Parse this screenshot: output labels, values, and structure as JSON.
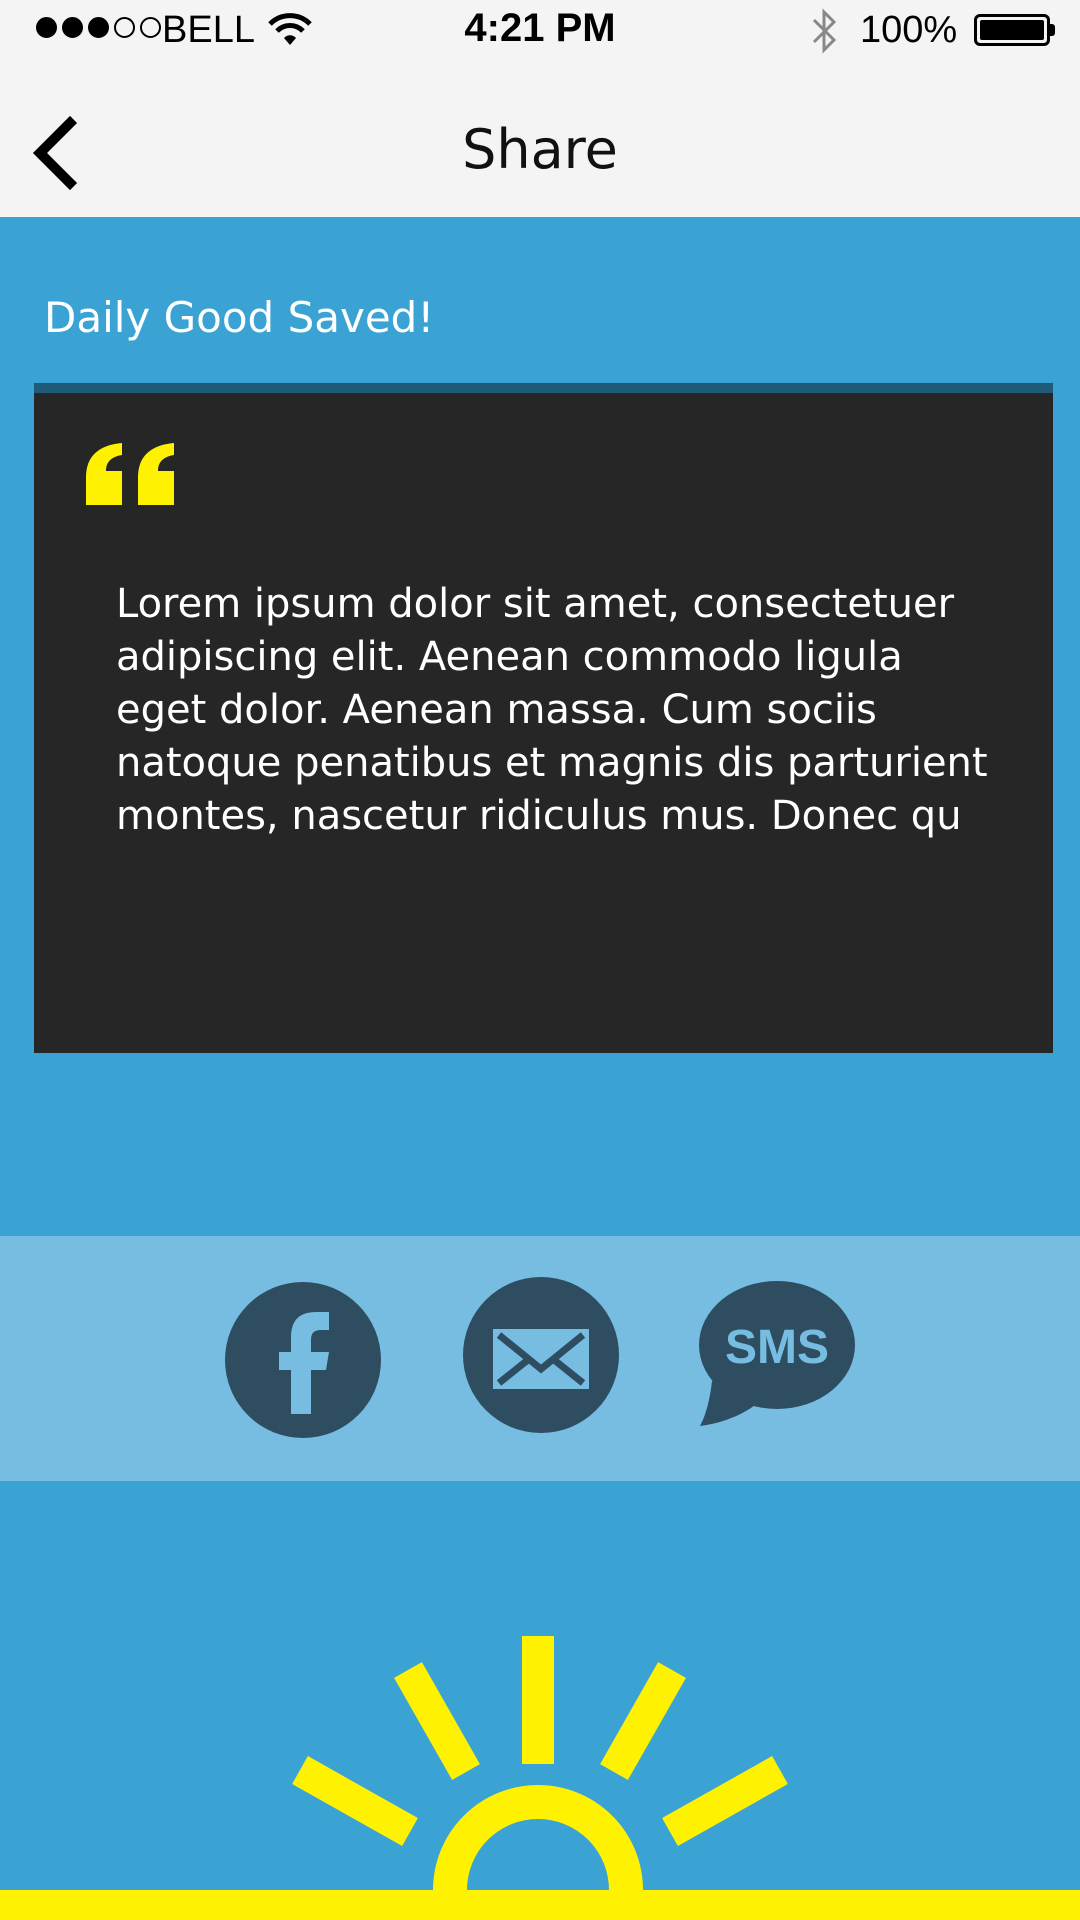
{
  "status_bar": {
    "carrier": "BELL",
    "time": "4:21 PM",
    "battery": "100%",
    "signal_strength": 3,
    "signal_max": 5
  },
  "nav": {
    "title": "Share",
    "back_icon": "chevron-left-icon"
  },
  "saved_message": "Daily Good Saved!",
  "quote": {
    "icon": "quote-icon",
    "text": "Lorem ipsum dolor sit amet, consectetuer adipiscing elit. Aenean commodo ligula eget dolor. Aenean massa. Cum sociis natoque penatibus et magnis dis parturient montes, nascetur ridiculus mus. Donec qu"
  },
  "share": {
    "facebook_icon": "facebook-icon",
    "email_icon": "email-icon",
    "sms_icon": "sms-icon",
    "sms_label": "SMS"
  },
  "colors": {
    "background": "#3ba3d4",
    "share_band": "#76bde1",
    "card": "#262626",
    "accent_yellow": "#fff200",
    "icon_dark": "#2e4d60"
  }
}
